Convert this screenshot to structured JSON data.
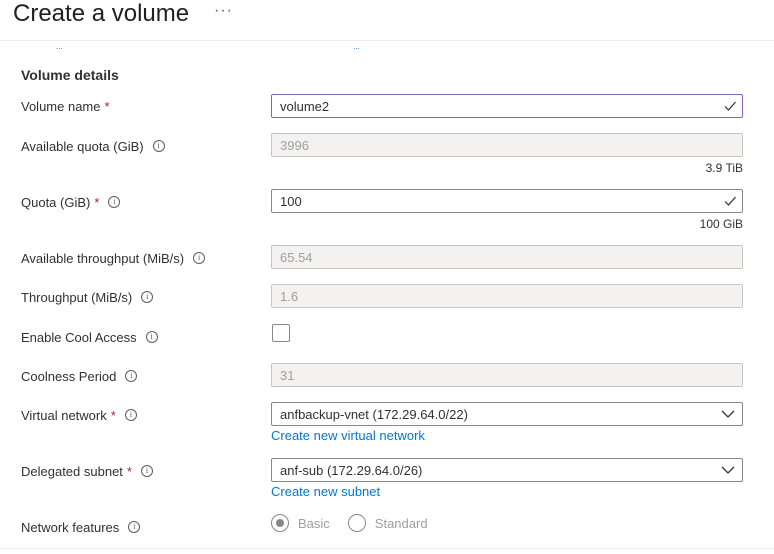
{
  "header": {
    "title": "Create a volume",
    "more": "···"
  },
  "cutoff": {
    "left": "...",
    "link": "..."
  },
  "section": {
    "title": "Volume details"
  },
  "fields": {
    "volume_name": {
      "label": "Volume name",
      "value": "volume2",
      "required": "*"
    },
    "available_quota": {
      "label": "Available quota (GiB)",
      "value": "3996",
      "hint": "3.9 TiB"
    },
    "quota": {
      "label": "Quota (GiB)",
      "value": "100",
      "required": "*",
      "hint": "100 GiB"
    },
    "available_throughput": {
      "label": "Available throughput (MiB/s)",
      "value": "65.54"
    },
    "throughput": {
      "label": "Throughput (MiB/s)",
      "value": "1.6"
    },
    "cool_access": {
      "label": "Enable Cool Access",
      "checked": false
    },
    "coolness_period": {
      "label": "Coolness Period",
      "value": "31"
    },
    "virtual_network": {
      "label": "Virtual network",
      "value": "anfbackup-vnet (172.29.64.0/22)",
      "required": "*",
      "link": "Create new virtual network"
    },
    "delegated_subnet": {
      "label": "Delegated subnet",
      "value": "anf-sub (172.29.64.0/26)",
      "required": "*",
      "link": "Create new subnet"
    },
    "network_features": {
      "label": "Network features",
      "options": [
        "Basic",
        "Standard"
      ],
      "selected": "Basic"
    }
  },
  "colors": {
    "accent": "#0078d4",
    "required": "#a4262c",
    "focus_border": "#8764b8",
    "disabled_bg": "#f3f2f1"
  }
}
